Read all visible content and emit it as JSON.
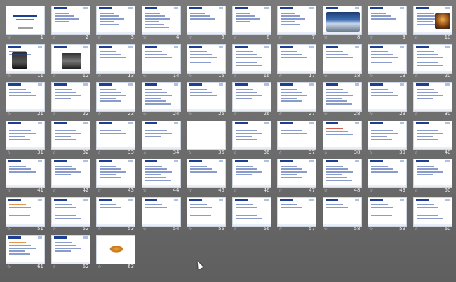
{
  "view": "slide-sorter",
  "slide_count": 63,
  "slides": [
    {
      "n": "1",
      "kind": "cover"
    },
    {
      "n": "2",
      "kind": "text"
    },
    {
      "n": "3",
      "kind": "text"
    },
    {
      "n": "4",
      "kind": "text"
    },
    {
      "n": "5",
      "kind": "text"
    },
    {
      "n": "6",
      "kind": "text"
    },
    {
      "n": "7",
      "kind": "text"
    },
    {
      "n": "8",
      "kind": "photo"
    },
    {
      "n": "9",
      "kind": "text"
    },
    {
      "n": "10",
      "kind": "night"
    },
    {
      "n": "11",
      "kind": "device"
    },
    {
      "n": "12",
      "kind": "machine"
    },
    {
      "n": "13",
      "kind": "text"
    },
    {
      "n": "14",
      "kind": "text"
    },
    {
      "n": "15",
      "kind": "text"
    },
    {
      "n": "16",
      "kind": "text"
    },
    {
      "n": "17",
      "kind": "text"
    },
    {
      "n": "18",
      "kind": "text"
    },
    {
      "n": "19",
      "kind": "text"
    },
    {
      "n": "20",
      "kind": "text"
    },
    {
      "n": "21",
      "kind": "text"
    },
    {
      "n": "22",
      "kind": "text"
    },
    {
      "n": "23",
      "kind": "text"
    },
    {
      "n": "24",
      "kind": "text"
    },
    {
      "n": "25",
      "kind": "text"
    },
    {
      "n": "26",
      "kind": "text"
    },
    {
      "n": "27",
      "kind": "text"
    },
    {
      "n": "28",
      "kind": "text"
    },
    {
      "n": "29",
      "kind": "text"
    },
    {
      "n": "30",
      "kind": "text"
    },
    {
      "n": "31",
      "kind": "text"
    },
    {
      "n": "32",
      "kind": "text"
    },
    {
      "n": "33",
      "kind": "text"
    },
    {
      "n": "34",
      "kind": "text"
    },
    {
      "n": "35",
      "kind": "blank"
    },
    {
      "n": "36",
      "kind": "text"
    },
    {
      "n": "37",
      "kind": "text"
    },
    {
      "n": "38",
      "kind": "red"
    },
    {
      "n": "39",
      "kind": "text"
    },
    {
      "n": "40",
      "kind": "text"
    },
    {
      "n": "41",
      "kind": "text"
    },
    {
      "n": "42",
      "kind": "text"
    },
    {
      "n": "43",
      "kind": "text"
    },
    {
      "n": "44",
      "kind": "text"
    },
    {
      "n": "45",
      "kind": "text"
    },
    {
      "n": "46",
      "kind": "text"
    },
    {
      "n": "47",
      "kind": "text"
    },
    {
      "n": "48",
      "kind": "text"
    },
    {
      "n": "49",
      "kind": "text"
    },
    {
      "n": "50",
      "kind": "text"
    },
    {
      "n": "51",
      "kind": "orange"
    },
    {
      "n": "52",
      "kind": "text"
    },
    {
      "n": "53",
      "kind": "text"
    },
    {
      "n": "54",
      "kind": "text"
    },
    {
      "n": "55",
      "kind": "text"
    },
    {
      "n": "56",
      "kind": "text"
    },
    {
      "n": "57",
      "kind": "text"
    },
    {
      "n": "58",
      "kind": "text"
    },
    {
      "n": "59",
      "kind": "text"
    },
    {
      "n": "60",
      "kind": "text"
    },
    {
      "n": "61",
      "kind": "orange"
    },
    {
      "n": "62",
      "kind": "text"
    },
    {
      "n": "63",
      "kind": "logo"
    }
  ],
  "transition_mark": "☆",
  "colors": {
    "title": "#1c3f94",
    "background": "#6a6a6a"
  }
}
